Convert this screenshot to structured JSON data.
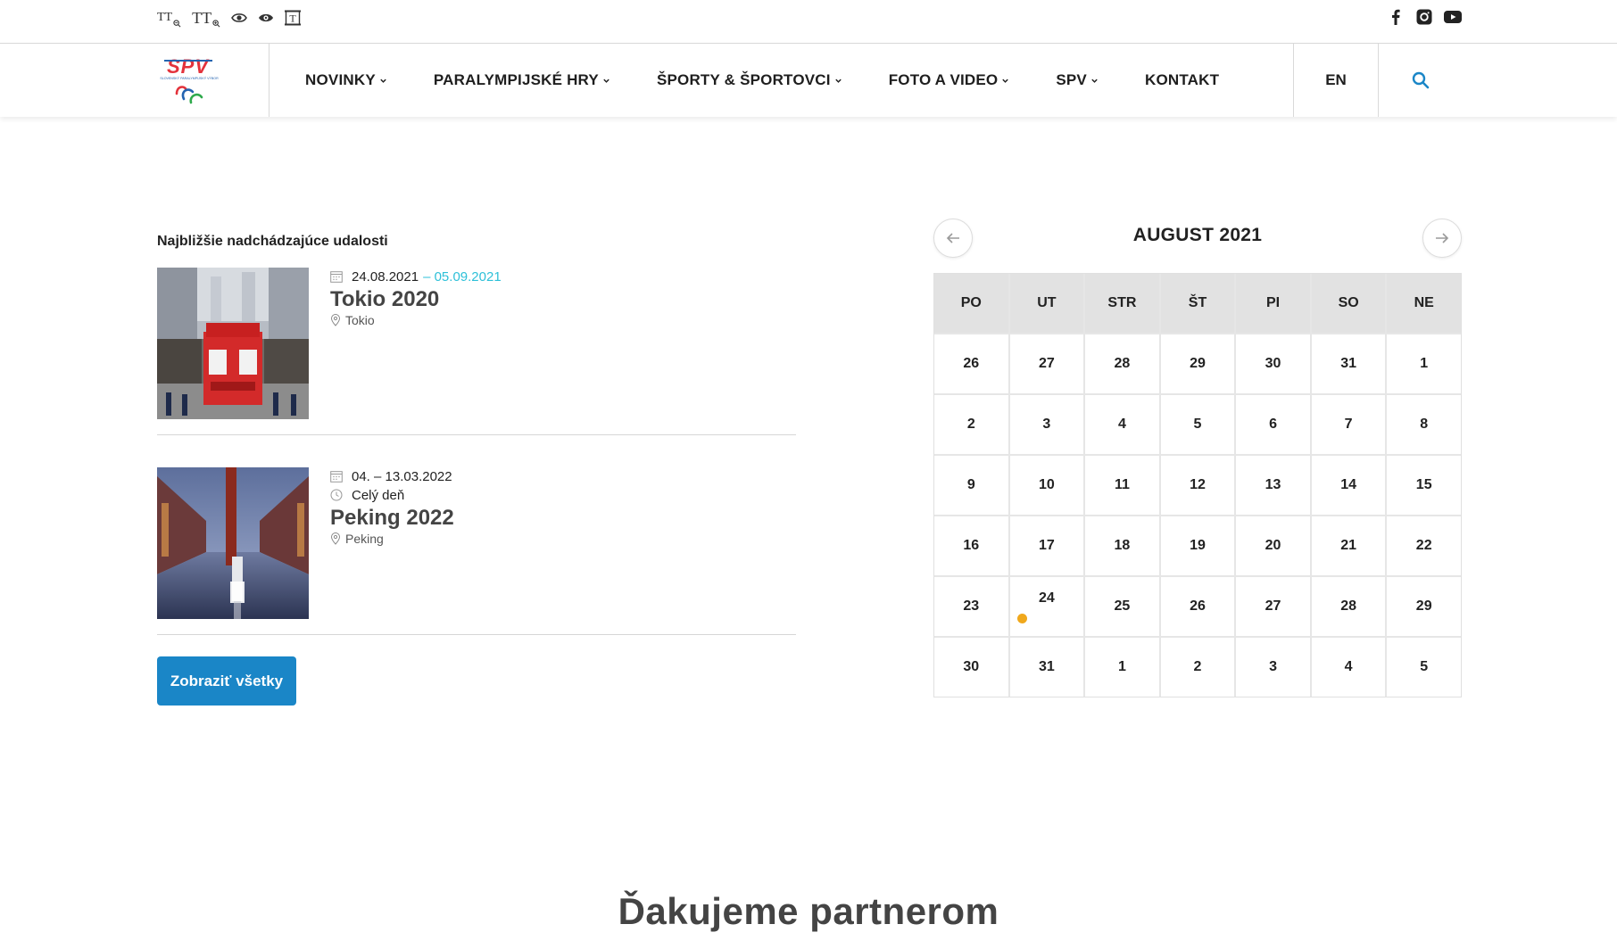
{
  "accessibility": {
    "text_smaller_label": "TT",
    "text_bigger_label": "TT",
    "contrast_icon": "eye-icon",
    "high_contrast_icon": "eye-filled-icon",
    "font_toggle_label": "T"
  },
  "social": [
    "facebook-icon",
    "instagram-icon",
    "youtube-icon"
  ],
  "logo": {
    "text": "SPV",
    "subtitle": "SLOVENSKÝ PARALYMPIJSKÝ VÝBOR"
  },
  "nav": {
    "items": [
      {
        "label": "NOVINKY",
        "dropdown": true
      },
      {
        "label": "PARALYMPIJSKÉ HRY",
        "dropdown": true
      },
      {
        "label": "ŠPORTY & ŠPORTOVCI",
        "dropdown": true
      },
      {
        "label": "FOTO A VIDEO",
        "dropdown": true
      },
      {
        "label": "SPV",
        "dropdown": true
      },
      {
        "label": "KONTAKT",
        "dropdown": false
      }
    ],
    "lang": "EN"
  },
  "events": {
    "title": "Najbližšie nadchádzajúce udalosti",
    "items": [
      {
        "date_from": "24.08.2021",
        "date_to": "– 05.09.2021",
        "time": "",
        "title": "Tokio 2020",
        "location": "Tokio"
      },
      {
        "date_from": "04. – 13.03.2022",
        "date_to": "",
        "time": "Celý deň",
        "title": "Peking 2022",
        "location": "Peking"
      }
    ],
    "show_all": "Zobraziť všetky"
  },
  "calendar": {
    "month": "AUGUST 2021",
    "weekdays": [
      "PO",
      "UT",
      "STR",
      "ŠT",
      "PI",
      "SO",
      "NE"
    ],
    "days": [
      "26",
      "27",
      "28",
      "29",
      "30",
      "31",
      "1",
      "2",
      "3",
      "4",
      "5",
      "6",
      "7",
      "8",
      "9",
      "10",
      "11",
      "12",
      "13",
      "14",
      "15",
      "16",
      "17",
      "18",
      "19",
      "20",
      "21",
      "22",
      "23",
      "24",
      "25",
      "26",
      "27",
      "28",
      "29",
      "30",
      "31",
      "1",
      "2",
      "3",
      "4",
      "5"
    ],
    "event_day_index": 29,
    "event_dot_color": "#f0a81c"
  },
  "partners_title": "Ďakujeme partnerom",
  "colors": {
    "accent": "#1a86c7",
    "date_to": "#2ec0d8",
    "logo_red": "#e3323b"
  }
}
